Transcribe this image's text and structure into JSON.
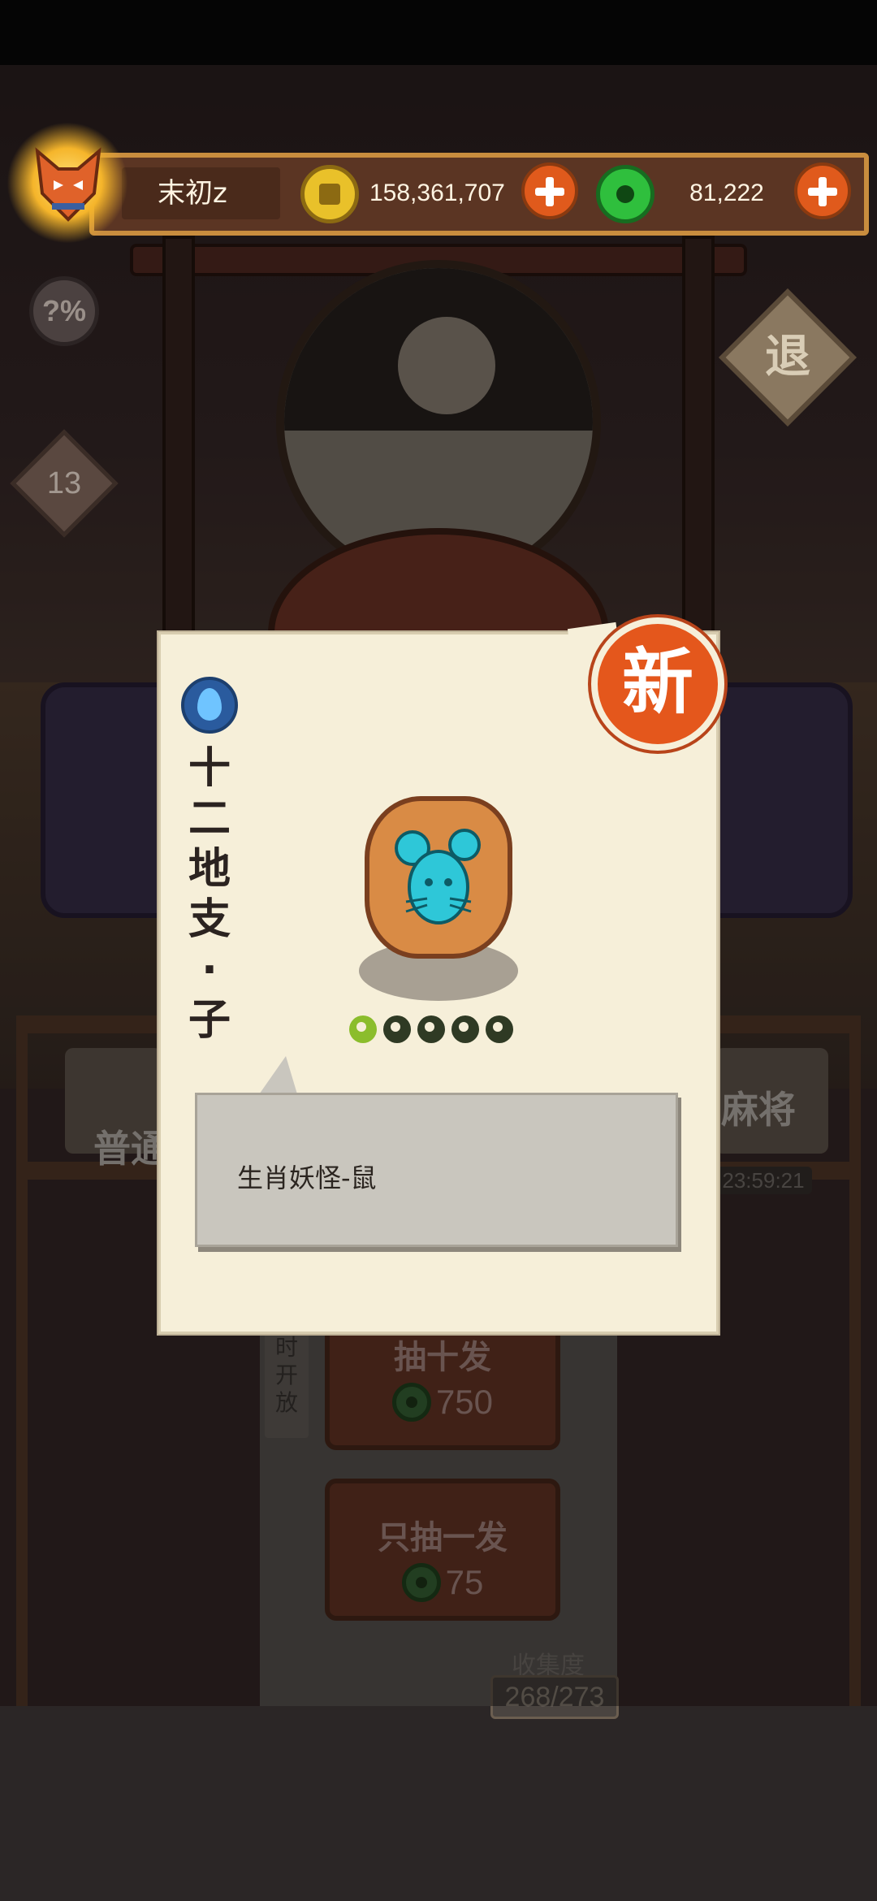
{
  "hud": {
    "player_name": "末初z",
    "coins": "158,361,707",
    "jade": "81,222"
  },
  "side": {
    "help_label": "?%",
    "level": "13",
    "exit_label": "退"
  },
  "gacha": {
    "banner_left": "普通",
    "banner_right": "麻将",
    "timer": "23:59:21",
    "side_open": "时开放",
    "draw_ten_label": "抽十发",
    "draw_ten_cost": "750",
    "draw_one_label": "只抽一发",
    "draw_one_cost": "75",
    "collect_label": "收集度",
    "collect_count": "268/273"
  },
  "card": {
    "new_badge": "新",
    "element_icon": "water-drop-icon",
    "title_chars": [
      "十",
      "二",
      "地",
      "支",
      "·",
      "子"
    ],
    "stars_total": 5,
    "stars_lit": 1,
    "description": "生肖妖怪-鼠"
  },
  "colors": {
    "accent_orange": "#e4571c",
    "coin_gold": "#e9c12a",
    "jade_green": "#2fbf3d",
    "card_paper": "#f6efd9"
  }
}
